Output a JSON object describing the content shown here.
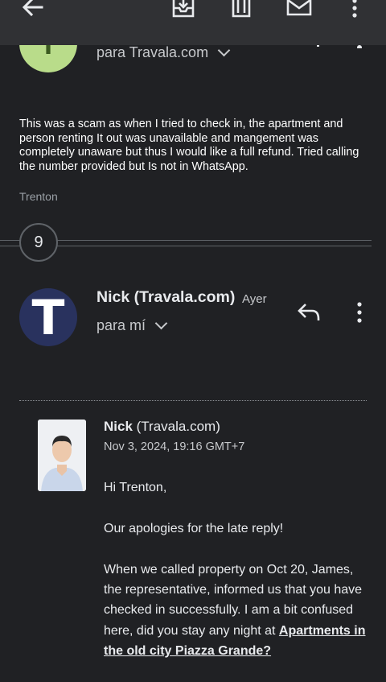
{
  "previous_message": {
    "avatar_letter": "T",
    "recipients": "para Travala.com",
    "body": "This was a scam as when I tried to check in, the apartment and person renting It out was unavailable and mangement was completely unaware but thus I would like a full refund. Tried calling the number provided but Is not in WhatsApp.",
    "signature": "Trenton"
  },
  "toolbar": {
    "icons": [
      "back-arrow-icon",
      "archive-icon",
      "delete-icon",
      "mark-unread-icon",
      "more-vert-icon"
    ]
  },
  "collapsed": {
    "count": "9"
  },
  "message": {
    "avatar_letter": "T",
    "sender": "Nick (Travala.com)",
    "date": "Ayer",
    "recipients": "para mí",
    "actions": [
      "reply-icon",
      "more-vert-icon"
    ]
  },
  "quoted": {
    "name_bold": "Nick",
    "name_rest": " (Travala.com)",
    "date": "Nov 3, 2024, 19:16 GMT+7",
    "greeting": "Hi Trenton,",
    "apology": "Our apologies for the late reply!",
    "body_text": "When we called property on Oct 20, James, the representative, informed us that you have checked in successfully. I am a bit confused here, did you stay any night at ",
    "link_text": "Apartments in the old city Piazza Grande?"
  },
  "colors": {
    "background": "#202124",
    "toolbar": "#303134",
    "avatar_nick": "#29325e",
    "avatar_prev": "#b9dc8a"
  }
}
